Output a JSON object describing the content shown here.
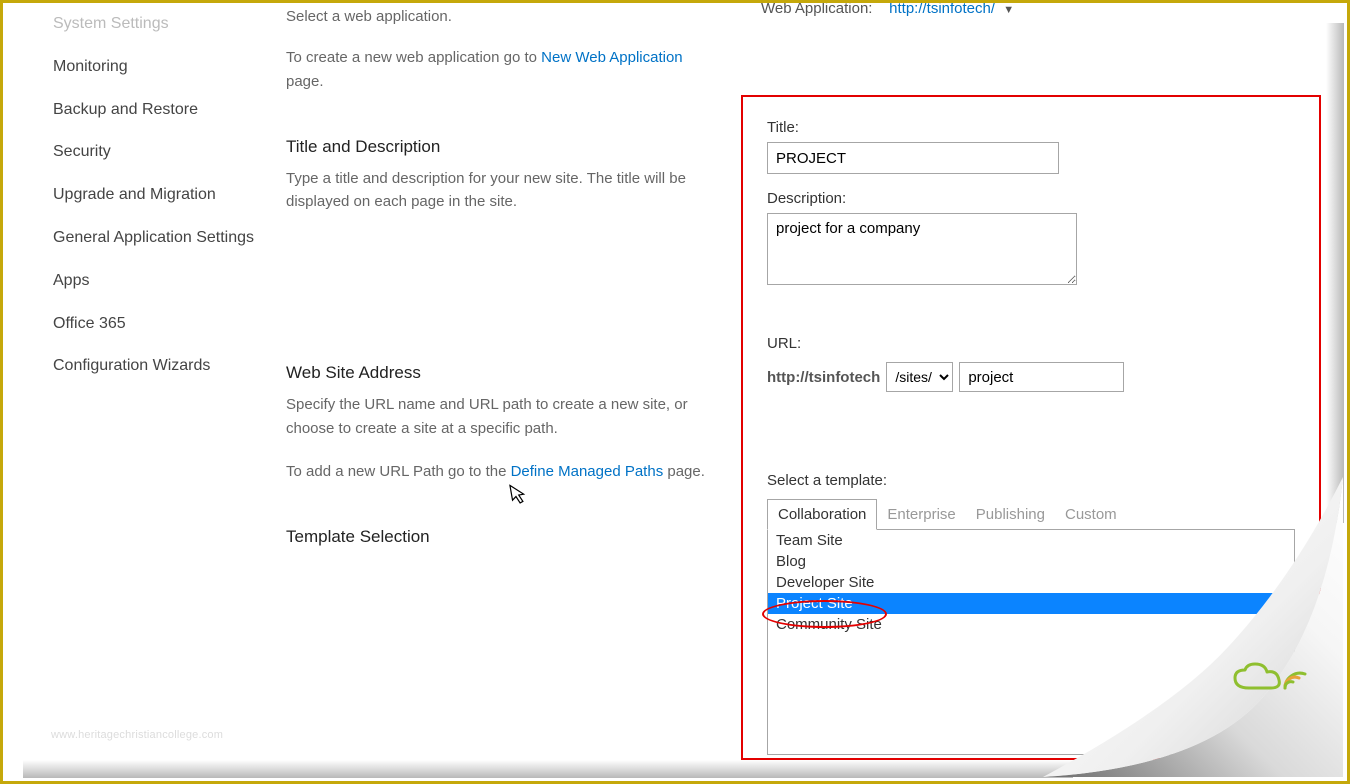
{
  "sidebar": {
    "items": [
      "System Settings",
      "Monitoring",
      "Backup and Restore",
      "Security",
      "Upgrade and Migration",
      "General Application Settings",
      "Apps",
      "Office 365",
      "Configuration Wizards"
    ]
  },
  "sections": {
    "webAppSelect": {
      "desc": "Select a web application.",
      "lead": "To create a new web application go to ",
      "link": "New Web Application",
      "trail": " page."
    },
    "titleDesc": {
      "title": "Title and Description",
      "desc": "Type a title and description for your new site. The title will be displayed on each page in the site."
    },
    "address": {
      "title": "Web Site Address",
      "desc": "Specify the URL name and URL path to create a new site, or choose to create a site at a specific path.",
      "lead": "To add a new URL Path go to the ",
      "link": "Define Managed Paths",
      "trail": " page."
    },
    "template": {
      "title": "Template Selection"
    }
  },
  "webAppRow": {
    "label": "Web Application:",
    "value": "http://tsinfotech/"
  },
  "form": {
    "titleLabel": "Title:",
    "titleValue": "PROJECT",
    "descLabel": "Description:",
    "descValue": "project for a company",
    "urlLabel": "URL:",
    "urlBase": "http://tsinfotech",
    "urlPath": "/sites/",
    "urlNameValue": "project",
    "templateLabel": "Select a template:",
    "tabs": [
      "Collaboration",
      "Enterprise",
      "Publishing",
      "Custom"
    ],
    "activeTab": 0,
    "templates": [
      "Team Site",
      "Blog",
      "Developer Site",
      "Project Site",
      "Community Site"
    ],
    "selectedTemplate": 3
  },
  "watermark": "www.heritagechristiancollege.com"
}
